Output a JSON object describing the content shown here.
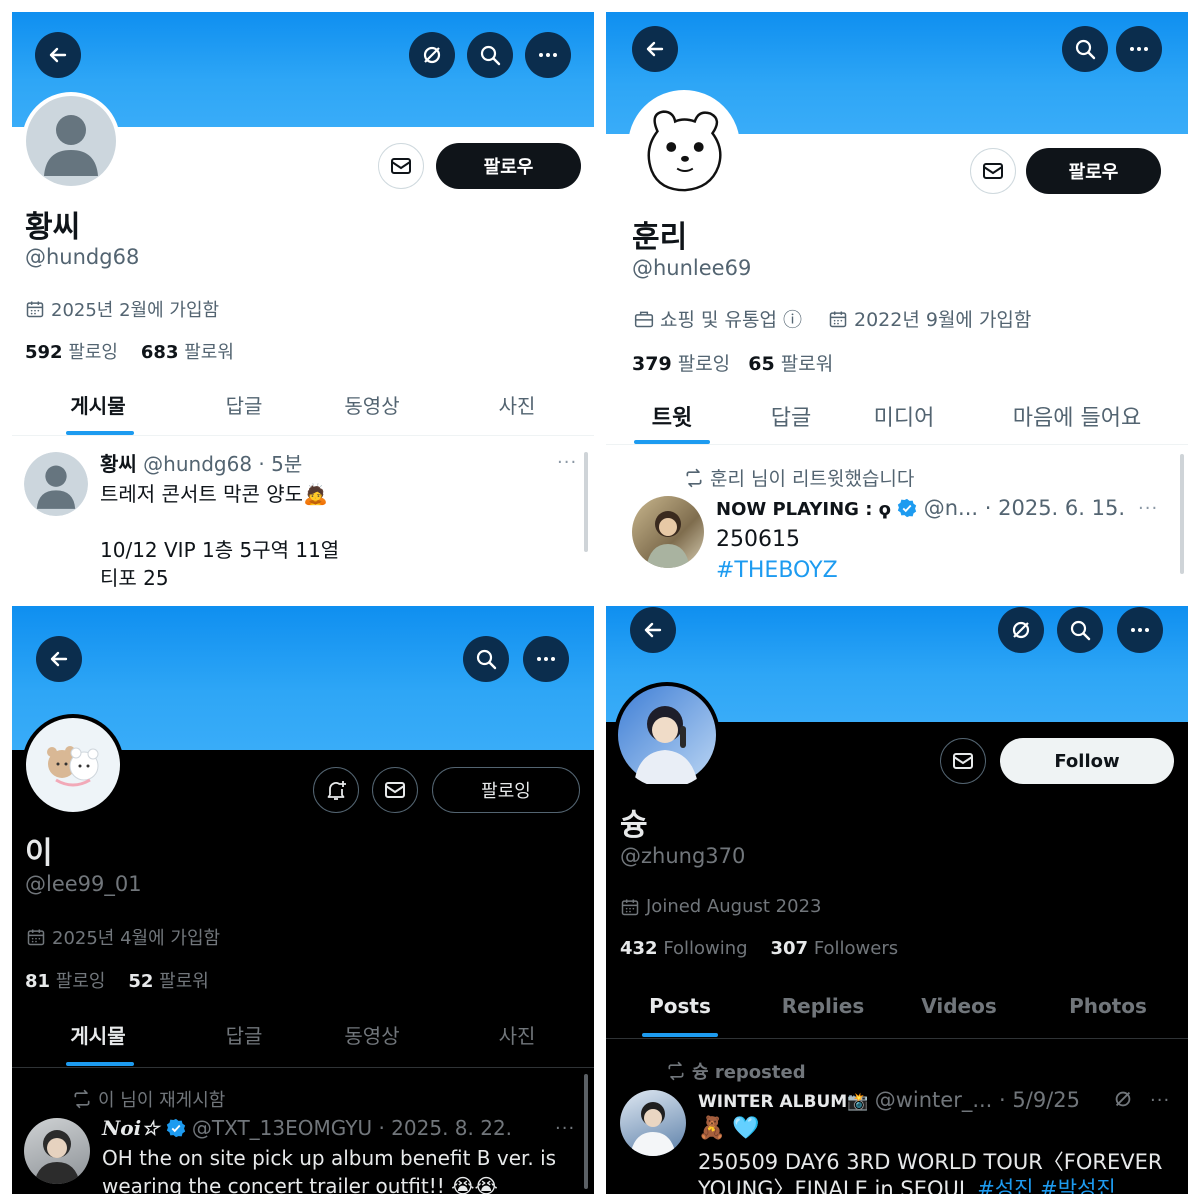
{
  "panel1": {
    "name": "황씨",
    "handle": "@hundg68",
    "joined": "2025년 2월에 가입함",
    "following_count": "592",
    "following_label": "팔로잉",
    "followers_count": "683",
    "followers_label": "팔로워",
    "follow_label": "팔로우",
    "tabs": [
      "게시물",
      "답글",
      "동영상",
      "사진"
    ],
    "post": {
      "author": "황씨",
      "handle_time": "@hundg68 · 5분",
      "line1": "트레저 콘서트 막콘 양도🙇",
      "line2": "10/12 VIP 1층 5구역 11열",
      "line3": "티포 25",
      "more": "···"
    }
  },
  "panel2": {
    "name": "훈리",
    "handle": "@hunlee69",
    "category": "쇼핑 및 유통업",
    "info_icon": "ⓘ",
    "joined": "2022년 9월에 가입함",
    "following_count": "379",
    "following_label": "팔로잉",
    "followers_count": "65",
    "followers_label": "팔로워",
    "follow_label": "팔로우",
    "tabs": [
      "트윗",
      "답글",
      "미디어",
      "마음에 들어요"
    ],
    "retweet_note": "훈리 님이 리트윗했습니다",
    "post": {
      "author": "NOW PLAYING : ϙ",
      "handle_time": "@n... · 2025. 6. 15.",
      "line1": "250615",
      "hashtag": "#THEBOYZ",
      "more": "···"
    }
  },
  "panel3": {
    "name": "이",
    "handle": "@lee99_01",
    "joined": "2025년 4월에 가입함",
    "following_count": "81",
    "following_label": "팔로잉",
    "followers_count": "52",
    "followers_label": "팔로워",
    "following_button": "팔로잉",
    "tabs": [
      "게시물",
      "답글",
      "동영상",
      "사진"
    ],
    "repost_note": "이 님이 재게시함",
    "post": {
      "author": "Noi☆",
      "handle_time": "@TXT_13EOMGYU · 2025. 8. 22.",
      "line1": "OH the on site pick up album benefit B ver. is",
      "line2": "wearing the concert trailer outfit!! 😭😭",
      "more": "···"
    }
  },
  "panel4": {
    "name": "슝",
    "handle": "@zhung370",
    "joined": "Joined August 2023",
    "following_count": "432",
    "following_label": "Following",
    "followers_count": "307",
    "followers_label": "Followers",
    "follow_label": "Follow",
    "tabs": [
      "Posts",
      "Replies",
      "Videos",
      "Photos"
    ],
    "repost_note": "슝 reposted",
    "post": {
      "author": "WINTER ALBUM📸",
      "handle_time": "@winter_... · 5/9/25",
      "emoji_line": "🧸 🩵",
      "line1": "250509 DAY6 3RD WORLD TOUR〈FOREVER",
      "line2": "YOUNG〉FINALE in SEOUL",
      "hashtags": "#성진 #박성진",
      "more": "···"
    }
  },
  "colors": {
    "banner": "#1d9bf0",
    "icon_circle": "#0b2d4d",
    "accent": "#1d9bf0",
    "dark_text": "#0f1419",
    "gray_text": "#536471"
  }
}
